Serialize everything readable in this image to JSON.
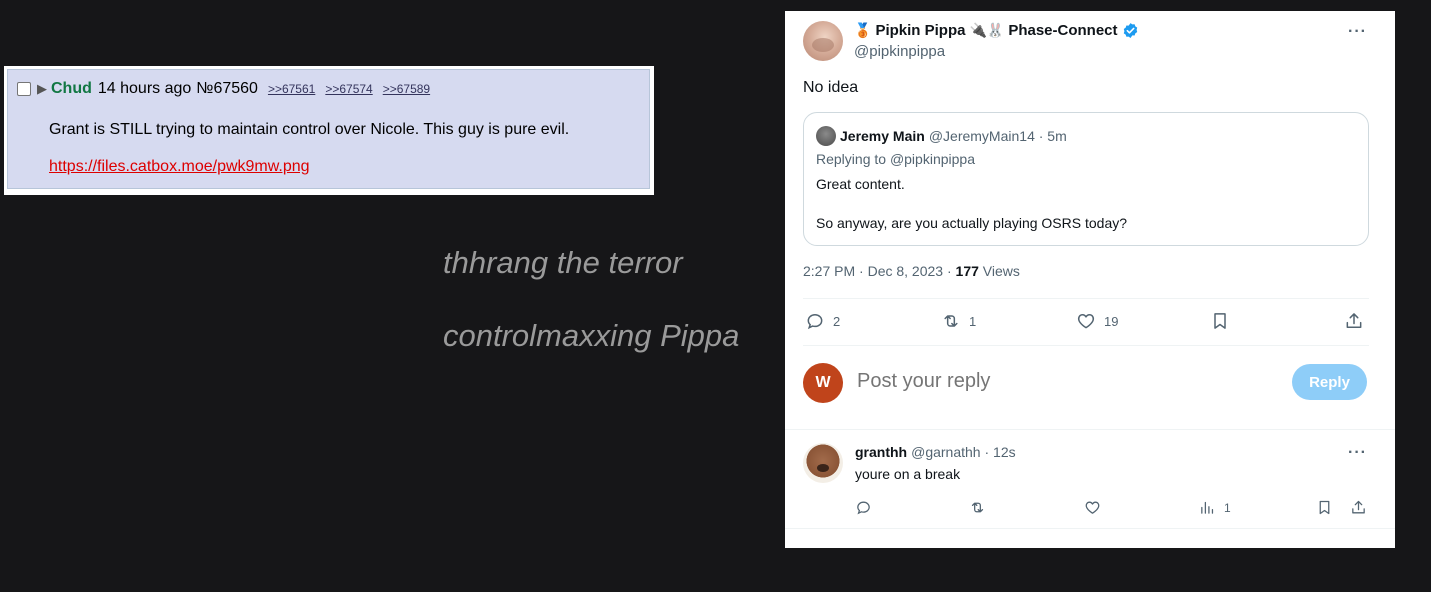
{
  "imageboard": {
    "name": "Chud",
    "time": "14 hours ago",
    "post_no": "№67560",
    "backlinks": [
      ">>67561",
      ">>67574",
      ">>67589"
    ],
    "body": "Grant is STILL trying to maintain control over Nicole. This guy is pure evil.",
    "link": "https://files.catbox.moe/pwk9mw.png",
    "colors": {
      "post_bg": "#d6daf0",
      "name": "#117743",
      "link": "#dd0000"
    }
  },
  "caption": {
    "line1": "thhrang the terror",
    "line2": "controlmaxxing Pippa"
  },
  "tweet": {
    "emoji_before": "🥉",
    "display_name": "Pipkin Pippa",
    "emoji_after": "🔌🐰",
    "affiliation": "Phase-Connect",
    "handle": "@pipkinpippa",
    "more": "···",
    "text": "No idea",
    "quote": {
      "name": "Jeremy Main",
      "handle_time": "@JeremyMain14 · 5m",
      "replying_to_prefix": "Replying to ",
      "replying_to_handle": "@pipkinpippa",
      "line1": "Great content.",
      "line2": "So anyway, are you actually playing OSRS today?"
    },
    "timestamp": "2:27 PM · Dec 8, 2023 · ",
    "views_count": "177",
    "views_label": " Views",
    "actions": {
      "replies": "2",
      "reposts": "1",
      "likes": "19"
    },
    "reply_box": {
      "avatar_letter": "W",
      "placeholder": "Post your reply",
      "button": "Reply"
    },
    "reply": {
      "name": "granthh",
      "handle_time": "@garnathh · 12s",
      "text": "youre on a break",
      "views": "1",
      "more": "···"
    },
    "colors": {
      "accent": "#1d9bf0",
      "muted": "#536471",
      "reply_avatar": "#c0441b"
    },
    "icons": [
      "verified-badge-icon",
      "reply-icon",
      "repost-icon",
      "like-icon",
      "bookmark-icon",
      "share-icon",
      "views-icon",
      "more-icon"
    ]
  }
}
